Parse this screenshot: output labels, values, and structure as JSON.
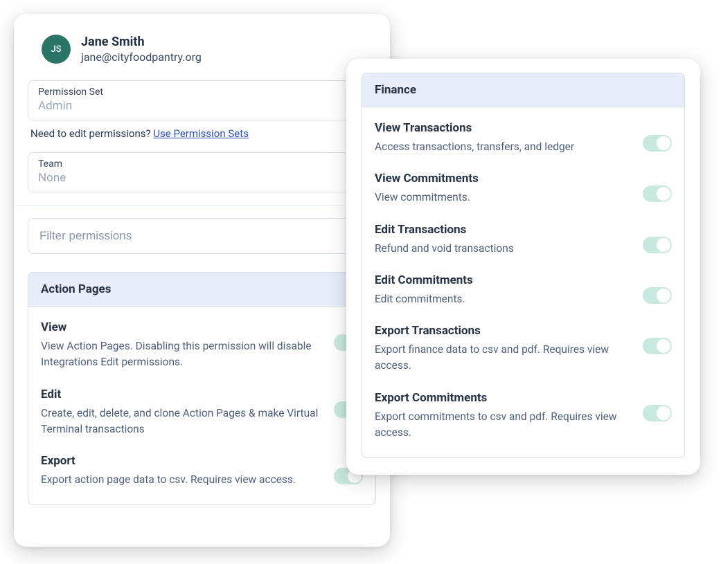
{
  "user": {
    "initials": "JS",
    "name": "Jane Smith",
    "email": "jane@cityfoodpantry.org"
  },
  "permission_set": {
    "label": "Permission Set",
    "value": "Admin"
  },
  "hint": {
    "text": "Need to edit permissions? ",
    "link": "Use Permission Sets"
  },
  "team": {
    "label": "Team",
    "value": "None"
  },
  "filter": {
    "placeholder": "Filter permissions"
  },
  "group_action_pages": {
    "title": "Action Pages",
    "perms": [
      {
        "title": "View",
        "desc": "View Action Pages. Disabling this permission will disable Integrations Edit permissions."
      },
      {
        "title": "Edit",
        "desc": "Create, edit, delete, and clone Action Pages & make Virtual Terminal transactions"
      },
      {
        "title": "Export",
        "desc": "Export action page data to csv. Requires view access."
      }
    ]
  },
  "group_finance": {
    "title": "Finance",
    "perms": [
      {
        "title": "View Transactions",
        "desc": "Access transactions, transfers, and ledger"
      },
      {
        "title": "View Commitments",
        "desc": "View commitments."
      },
      {
        "title": "Edit Transactions",
        "desc": "Refund and void transactions"
      },
      {
        "title": "Edit Commitments",
        "desc": "Edit commitments."
      },
      {
        "title": "Export Transactions",
        "desc": "Export finance data to csv and pdf. Requires view access."
      },
      {
        "title": "Export Commitments",
        "desc": "Export commitments to csv and pdf. Requires view access."
      }
    ]
  }
}
